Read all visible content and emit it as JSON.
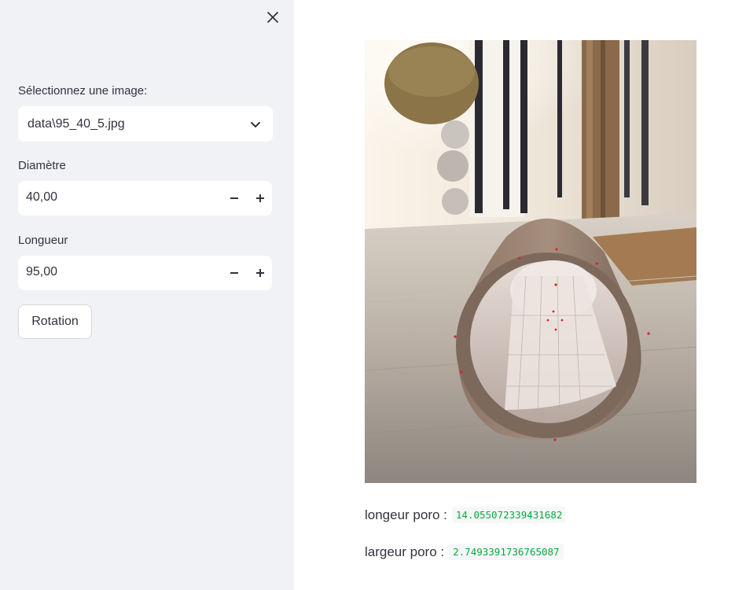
{
  "sidebar": {
    "image_select": {
      "label": "Sélectionnez une image:",
      "value": "data\\95_40_5.jpg"
    },
    "diametre": {
      "label": "Diamètre",
      "value": "40,00"
    },
    "longueur": {
      "label": "Longueur",
      "value": "95,00"
    },
    "rotation_button": "Rotation"
  },
  "main": {
    "results": [
      {
        "label": "longeur poro :",
        "value": "14.055072339431682"
      },
      {
        "label": "largeur poro :",
        "value": "2.7493391736765087"
      }
    ]
  },
  "colors": {
    "sidebar_bg": "#f0f2f6",
    "code_text": "#09ab3b",
    "marker": "#e0202a"
  },
  "icons": [
    "close-icon",
    "chevron-down-icon",
    "minus-icon",
    "plus-icon"
  ]
}
